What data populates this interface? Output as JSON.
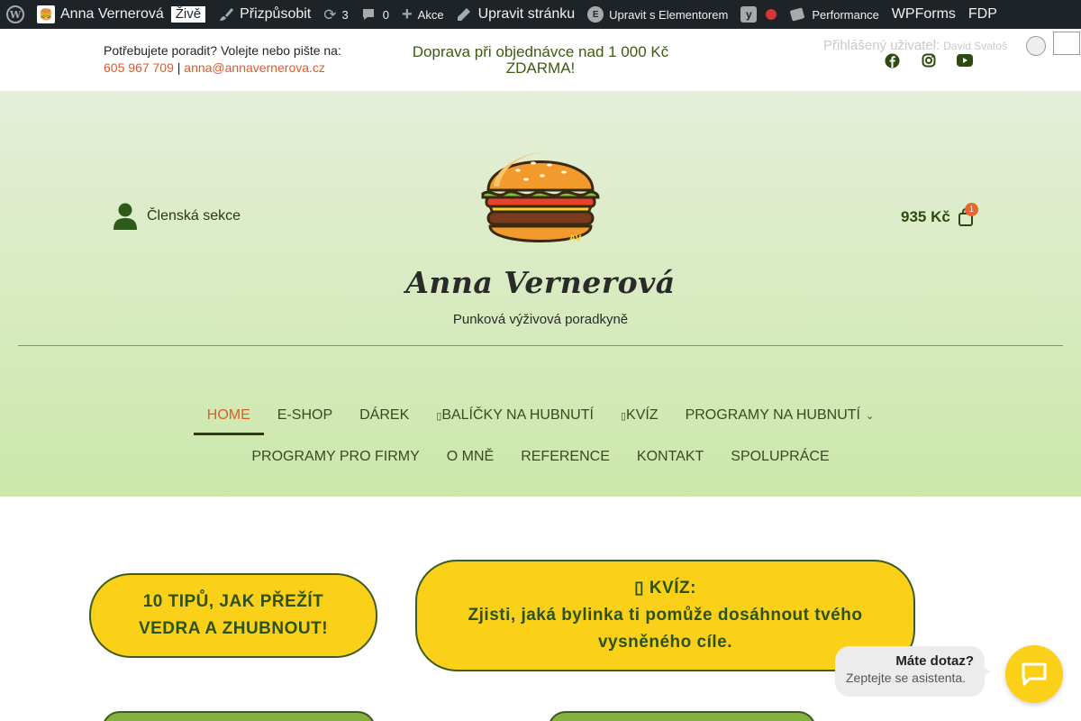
{
  "admin_bar": {
    "site_name": "Anna Vernerová",
    "live": "Živě",
    "customize": "Přizpůsobit",
    "updates_count": "3",
    "comments_count": "0",
    "new_label": "Akce",
    "edit_page": "Upravit stránku",
    "elementor": "Upravit s Elementorem",
    "performance": "Performance",
    "wpforms": "WPForms",
    "fdp": "FDP"
  },
  "topbar": {
    "contact_prompt": "Potřebujete poradit? Volejte nebo pište na:",
    "phone": "605 967 709",
    "separator": "|",
    "email": "anna@annavernerova.cz",
    "shipping_line1": "Doprava při objednávce nad 1 000 Kč",
    "shipping_line2": "ZDARMA!",
    "logged_in_label": "Přihlášený uživatel:",
    "username": "David Svatoš"
  },
  "header": {
    "member_section": "Členská sekce",
    "brand": "Anna Vernerová",
    "tagline": "Punková výživová poradkyně",
    "cart_total": "935 Kč",
    "cart_count": "1"
  },
  "nav": {
    "row1": [
      "HOME",
      "E-SHOP",
      "DÁREK",
      "BALÍČKY NA HUBNUTÍ",
      "KVÍZ",
      "PROGRAMY NA HUBNUTÍ"
    ],
    "row2": [
      "PROGRAMY PRO FIRMY",
      "O MNĚ",
      "REFERENCE",
      "KONTAKT",
      "SPOLUPRÁCE"
    ],
    "missing_glyph": "▯"
  },
  "content": {
    "tips_line1": "10 TIPŮ, JAK PŘEŽÍT",
    "tips_line2": "VEDRA A ZHUBNOUT!",
    "quiz_line1": "▯ KVÍZ:",
    "quiz_line2": "Zjisti, jaká bylinka ti pomůže dosáhnout tvého",
    "quiz_line3": "vysněného cíle."
  },
  "chat": {
    "question": "Máte dotaz?",
    "prompt": "Zeptejte se asistenta."
  },
  "colors": {
    "adminbar_bg": "#1d2327",
    "accent_orange": "#e05a28",
    "pill_yellow": "#fad018",
    "dark_green": "#3e5a1c"
  }
}
